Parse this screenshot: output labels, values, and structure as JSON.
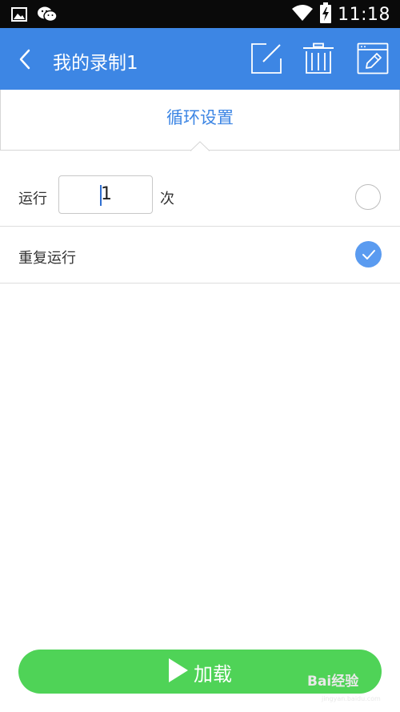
{
  "status_bar": {
    "time": "11:18",
    "icons": [
      "gallery-icon",
      "wechat-icon",
      "wifi-icon",
      "battery-charging-icon"
    ]
  },
  "header": {
    "title": "我的录制1",
    "actions": [
      "edit-icon",
      "trash-icon",
      "window-edit-icon"
    ]
  },
  "section": {
    "title": "循环设置"
  },
  "rows": {
    "run_times": {
      "prefix": "运行",
      "value": "1",
      "suffix": "次",
      "selected": false
    },
    "repeat": {
      "label": "重复运行",
      "selected": true
    }
  },
  "load_button": {
    "label": "加载",
    "icon": "play-icon"
  },
  "watermark": {
    "text": "Bai经验",
    "sub": "jingyan.baidu.com"
  },
  "colors": {
    "header_bg": "#3d86e4",
    "accent": "#3d86e4",
    "check_bg": "#5a9bf0",
    "button_bg": "#4fd357"
  }
}
